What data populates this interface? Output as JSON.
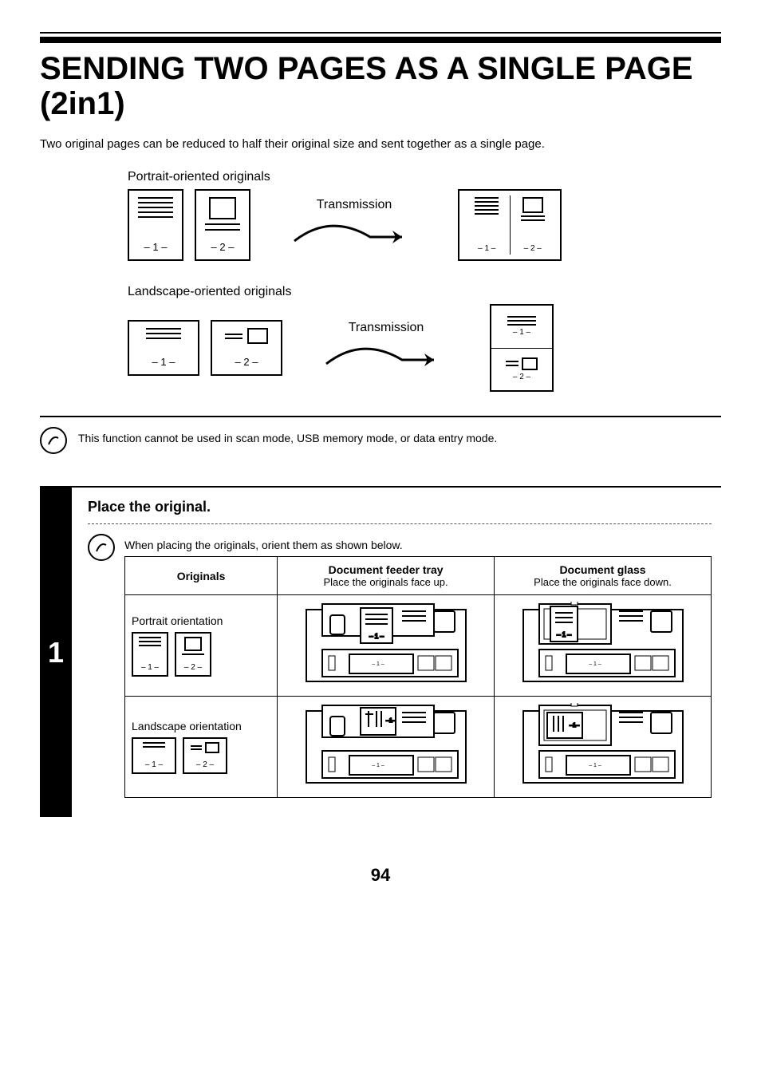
{
  "title": "SENDING TWO PAGES AS A SINGLE PAGE (2in1)",
  "intro": "Two original pages can be reduced to half their original size and sent together as a single page.",
  "diagrams": {
    "portrait_label": "Portrait-oriented originals",
    "landscape_label": "Landscape-oriented originals",
    "transmission": "Transmission",
    "p1": "1",
    "p2": "2"
  },
  "note1": "This function cannot be used in scan mode, USB memory mode, or data entry mode.",
  "step": {
    "num": "1",
    "title": "Place the original.",
    "note": "When placing the originals, orient them as shown below.",
    "col_originals": "Originals",
    "col_feeder": "Document feeder tray",
    "col_feeder_sub": "Place the originals face up.",
    "col_glass": "Document glass",
    "col_glass_sub": "Place the originals face down.",
    "row_portrait": "Portrait orientation",
    "row_landscape": "Landscape orientation"
  },
  "page_number": "94"
}
